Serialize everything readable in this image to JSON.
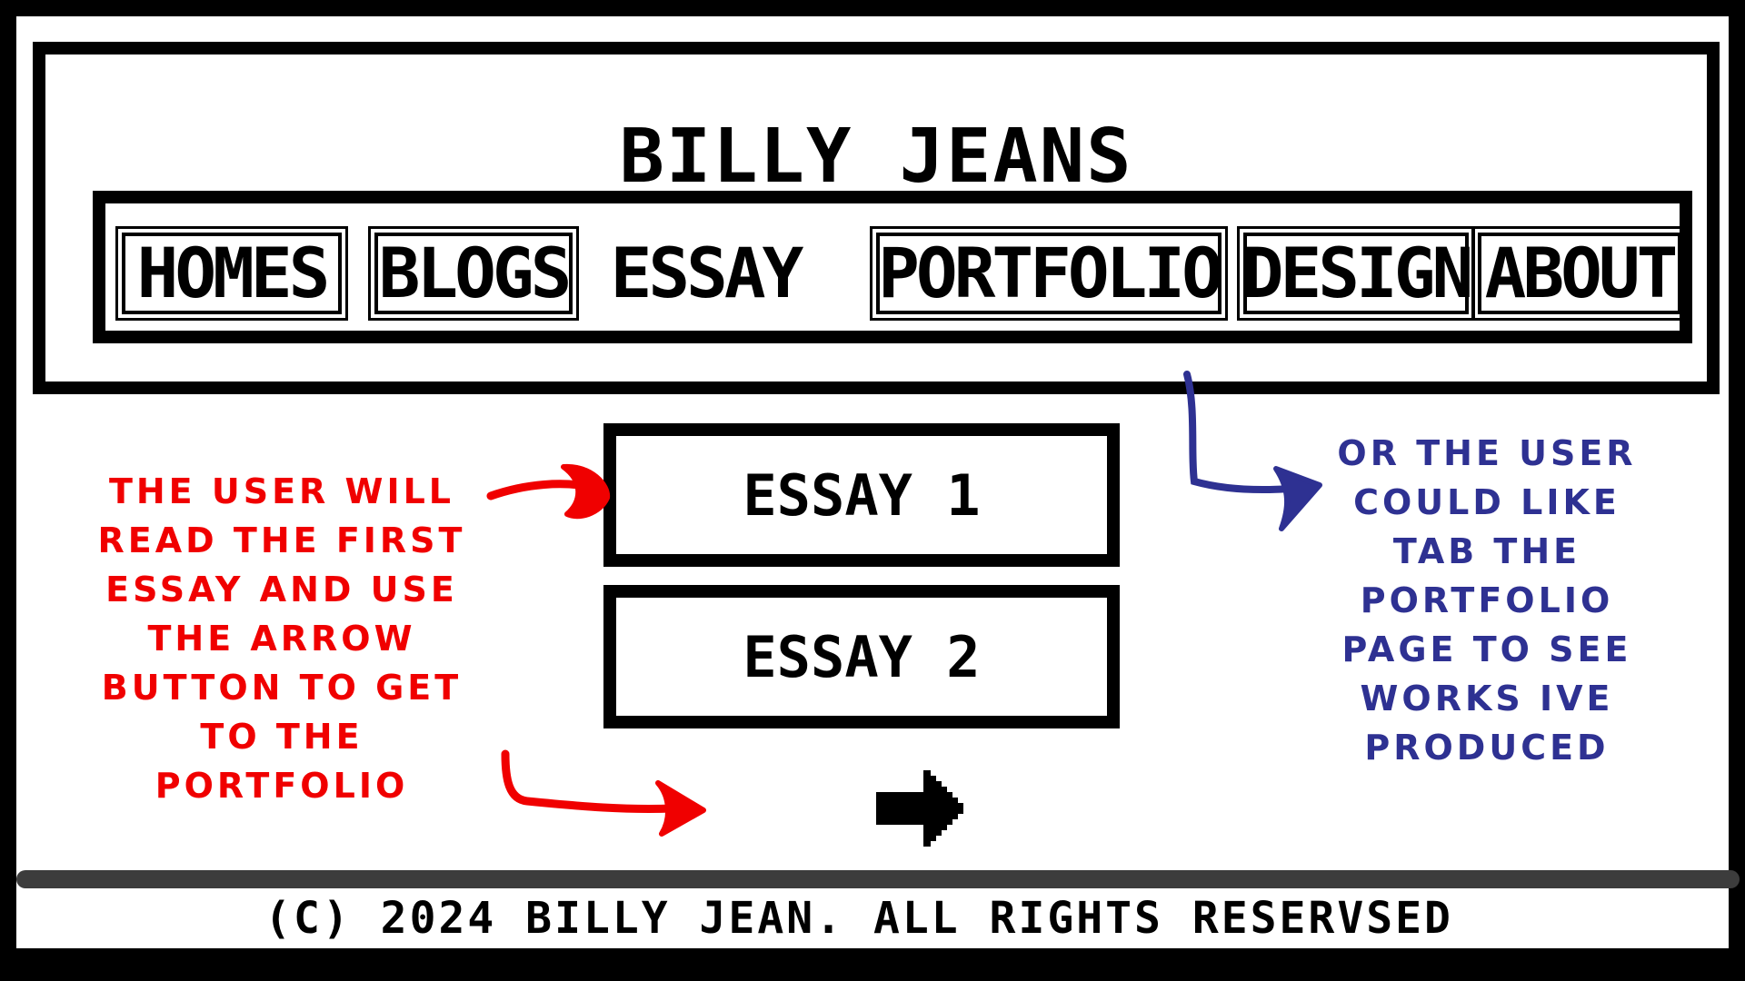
{
  "header": {
    "site_title": "BILLY JEANS"
  },
  "nav": {
    "items": [
      {
        "label": "HOMES",
        "boxed": true
      },
      {
        "label": "BLOGS",
        "boxed": true
      },
      {
        "label": "ESSAY",
        "boxed": false
      },
      {
        "label": "PORTFOLIO",
        "boxed": true
      },
      {
        "label": "DESIGN",
        "boxed": true
      },
      {
        "label": "ABOUT",
        "boxed": true
      }
    ]
  },
  "main": {
    "essays": [
      {
        "label": "ESSAY 1"
      },
      {
        "label": "ESSAY 2"
      }
    ],
    "next_icon": "right-arrow-icon"
  },
  "annotations": {
    "left_note": "THE USER WILL\nREAD THE FIRST\nESSAY AND USE\nTHE ARROW\nBUTTON TO GET\nTO THE\nPORTFOLIO",
    "right_note": "OR THE USER\nCOULD LIKE\nTAB THE\nPORTFOLIO\nPAGE TO SEE\nWORKS IVE\nPRODUCED",
    "left_color": "#f00000",
    "right_color": "#2e3192"
  },
  "footer": {
    "copyright": "(C) 2024 BILLY JEAN. ALL RIGHTS RESERVSED"
  }
}
